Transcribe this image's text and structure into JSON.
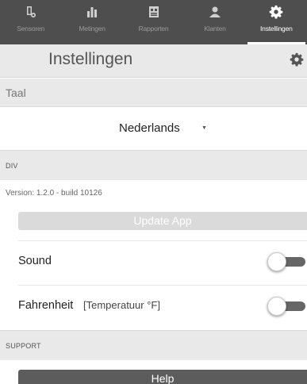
{
  "tabs": [
    {
      "label": "Sensoren",
      "icon": "sensor-icon",
      "active": false
    },
    {
      "label": "Metingen",
      "icon": "bar-chart-icon",
      "active": false
    },
    {
      "label": "Rapporten",
      "icon": "report-icon",
      "active": false
    },
    {
      "label": "Klanten",
      "icon": "customers-icon",
      "active": false
    },
    {
      "label": "Instellingen",
      "icon": "gear-icon",
      "active": true
    }
  ],
  "header": {
    "title": "Instellingen",
    "icon": "gear-icon"
  },
  "language": {
    "section_label": "Taal",
    "selected": "Nederlands"
  },
  "div_section": {
    "label": "DIV",
    "version": "Version: 1.2.0 - build 10126",
    "update_label": "Update App"
  },
  "settings": {
    "sound": {
      "label": "Sound",
      "on": false
    },
    "fahrenheit": {
      "label": "Fahrenheit",
      "hint": "[Temperatuur °F]",
      "on": false
    }
  },
  "support": {
    "label": "SUPPORT",
    "help_label": "Help"
  },
  "colors": {
    "tabbar": "#4e4e4e",
    "section_bg": "#e9e9e9",
    "help_button": "#5c5c5c",
    "update_button": "#dadada",
    "toggle_track": "#666666"
  }
}
